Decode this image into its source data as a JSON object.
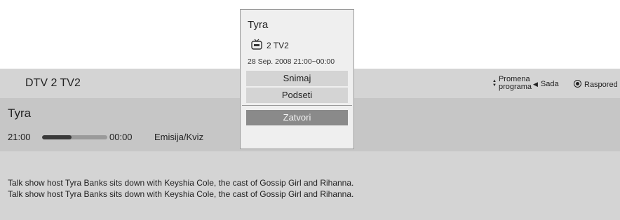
{
  "header": {
    "channel": "DTV 2  TV2",
    "controls": {
      "program_line1": "Promena",
      "program_line2": "programa",
      "now": "Sada",
      "schedule": "Raspored"
    }
  },
  "program": {
    "title": "Tyra",
    "start_time": "21:00",
    "end_time": "00:00",
    "genre": "Emisija/Kviz",
    "progress": 0.45,
    "description_lines": [
      "Talk show host Tyra Banks sits down with Keyshia Cole, the cast of Gossip Girl and Rihanna.",
      "Talk show host Tyra Banks sits down with Keyshia Cole, the cast of Gossip Girl and Rihanna."
    ]
  },
  "popup": {
    "title": "Tyra",
    "channel": "2 TV2",
    "datetime": "28 Sep. 2008 21:00~00:00",
    "record_label": "Snimaj",
    "remind_label": "Podseti",
    "close_label": "Zatvori"
  },
  "icons": {
    "channel_icon": "tv-icon",
    "program_change_icon": "up-down-arrows-icon",
    "now_icon": "left-triangle-icon",
    "schedule_icon": "radio-dot-icon"
  },
  "colors": {
    "header_bg": "#d4d4d4",
    "info_bg": "#c6c6c6",
    "popup_bg": "#efefef",
    "button_bg": "#d4d4d4",
    "close_button_bg": "#8a8a8a"
  }
}
